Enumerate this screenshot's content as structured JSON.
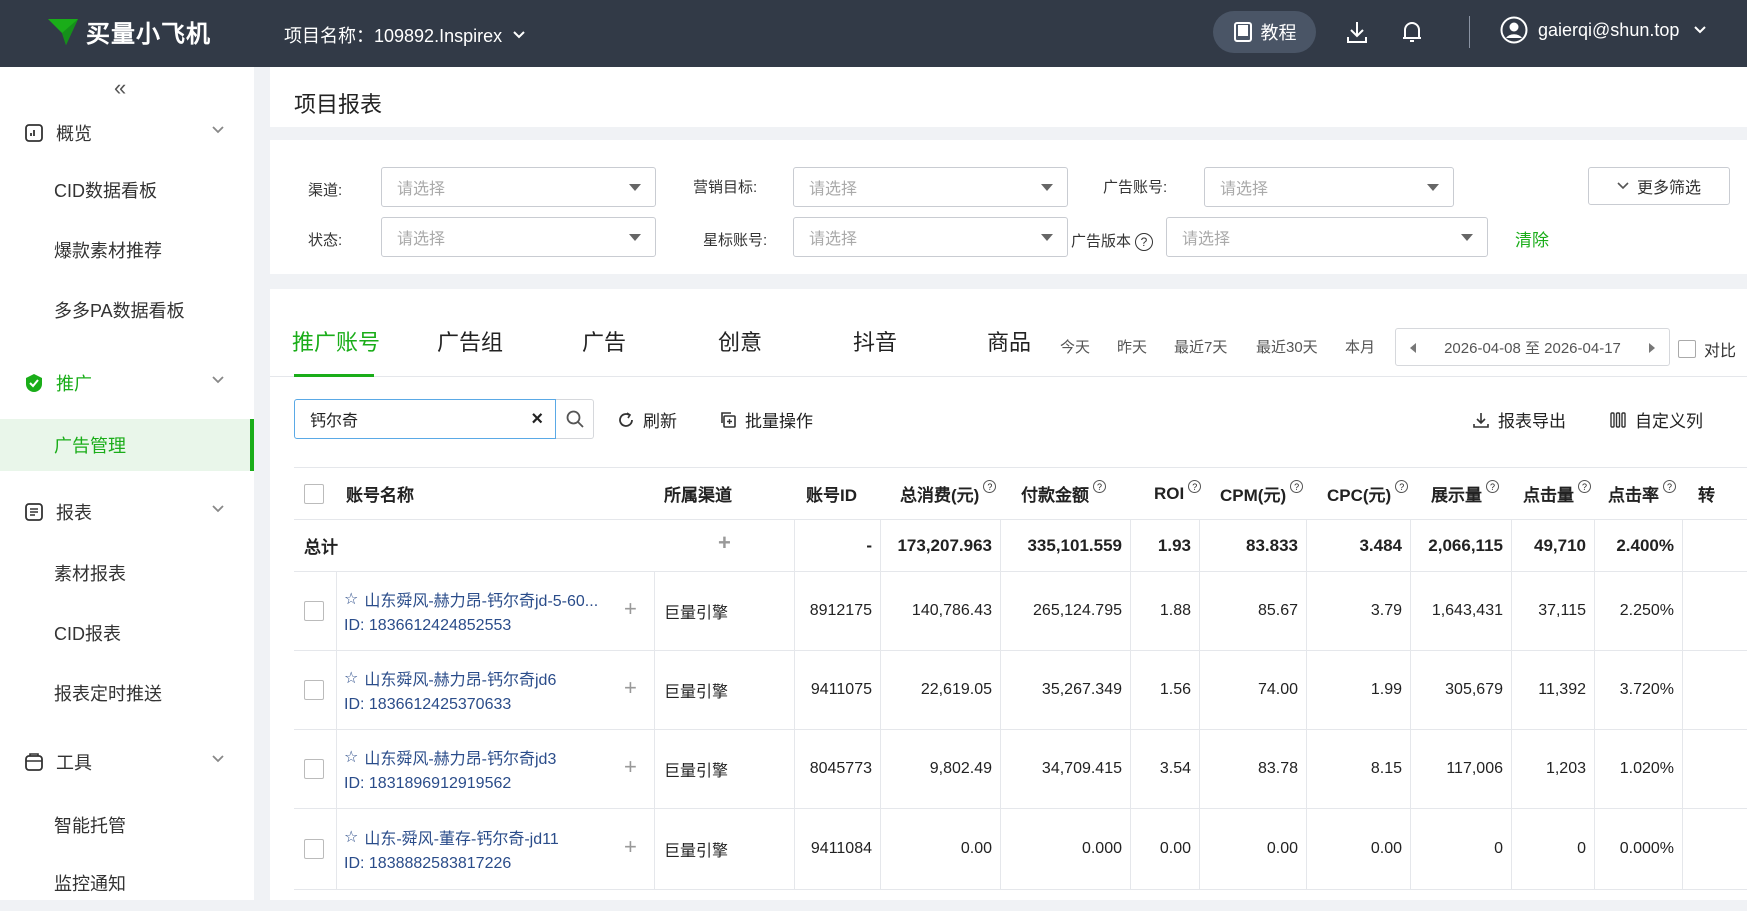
{
  "app": {
    "title": "买量小飞机"
  },
  "header": {
    "project_label": "项目名称：109892.Inspirex",
    "tutorial": "教程",
    "user_email": "gaierqi@shun.top"
  },
  "sidebar": {
    "collapse": "«",
    "groups": [
      {
        "label": "概览",
        "items": [
          "CID数据看板",
          "爆款素材推荐",
          "多多PA数据看板"
        ]
      },
      {
        "label": "推广",
        "items": [
          "广告管理"
        ]
      },
      {
        "label": "报表",
        "items": [
          "素材报表",
          "CID报表",
          "报表定时推送"
        ]
      },
      {
        "label": "工具",
        "items": [
          "智能托管",
          "监控通知"
        ]
      }
    ]
  },
  "page": {
    "title": "项目报表"
  },
  "filters": {
    "channel_label": "渠道:",
    "goal_label": "营销目标:",
    "account_label": "广告账号:",
    "status_label": "状态:",
    "star_label": "星标账号:",
    "version_label": "广告版本",
    "placeholder": "请选择",
    "more": "更多筛选",
    "clear": "清除"
  },
  "tabs": [
    "推广账号",
    "广告组",
    "广告",
    "创意",
    "抖音",
    "商品"
  ],
  "quick_dates": [
    "今天",
    "昨天",
    "最近7天",
    "最近30天",
    "本月"
  ],
  "date_range": "2026-04-08 至 2026-04-17",
  "compare": "对比",
  "toolbar": {
    "search_value": "钙尔奇",
    "refresh": "刷新",
    "batch": "批量操作",
    "export": "报表导出",
    "custom_columns": "自定义列"
  },
  "table": {
    "headers": {
      "name": "账号名称",
      "channel": "所属渠道",
      "account_id": "账号ID",
      "cost": "总消费(元)",
      "pay": "付款金额",
      "roi": "ROI",
      "cpm": "CPM(元)",
      "cpc": "CPC(元)",
      "impressions": "展示量",
      "clicks": "点击量",
      "ctr": "点击率",
      "conv": "转"
    },
    "total": {
      "label": "总计",
      "account_id": "-",
      "cost": "173,207.963",
      "pay": "335,101.559",
      "roi": "1.93",
      "cpm": "83.833",
      "cpc": "3.484",
      "impressions": "2,066,115",
      "clicks": "49,710",
      "ctr": "2.400%"
    },
    "rows": [
      {
        "name": "山东舜风-赫力昂-钙尔奇jd-5-60...",
        "id_text": "ID: 1836612424852553",
        "channel": "巨量引擎",
        "account_id": "8912175",
        "cost": "140,786.43",
        "pay": "265,124.795",
        "roi": "1.88",
        "cpm": "85.67",
        "cpc": "3.79",
        "impressions": "1,643,431",
        "clicks": "37,115",
        "ctr": "2.250%"
      },
      {
        "name": "山东舜风-赫力昂-钙尔奇jd6",
        "id_text": "ID: 1836612425370633",
        "channel": "巨量引擎",
        "account_id": "9411075",
        "cost": "22,619.05",
        "pay": "35,267.349",
        "roi": "1.56",
        "cpm": "74.00",
        "cpc": "1.99",
        "impressions": "305,679",
        "clicks": "11,392",
        "ctr": "3.720%"
      },
      {
        "name": "山东舜风-赫力昂-钙尔奇jd3",
        "id_text": "ID: 1831896912919562",
        "channel": "巨量引擎",
        "account_id": "8045773",
        "cost": "9,802.49",
        "pay": "34,709.415",
        "roi": "3.54",
        "cpm": "83.78",
        "cpc": "8.15",
        "impressions": "117,006",
        "clicks": "1,203",
        "ctr": "1.020%"
      },
      {
        "name": "山东-舜风-董存-钙尔奇-jd11",
        "id_text": "ID: 1838882583817226",
        "channel": "巨量引擎",
        "account_id": "9411084",
        "cost": "0.00",
        "pay": "0.000",
        "roi": "0.00",
        "cpm": "0.00",
        "cpc": "0.00",
        "impressions": "0",
        "clicks": "0",
        "ctr": "0.000%"
      }
    ]
  }
}
